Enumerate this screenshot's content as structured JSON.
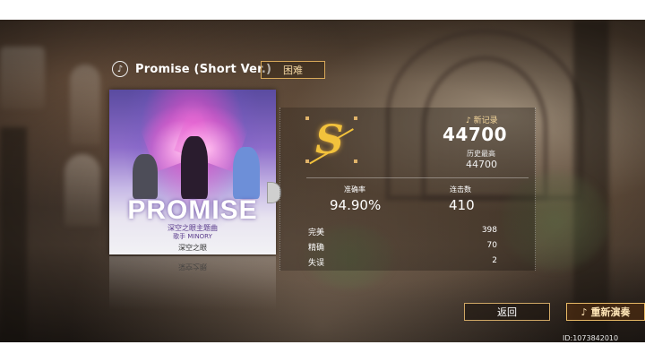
{
  "song": {
    "title": "Promise (Short Ver.)",
    "difficulty": "困难",
    "disc_icon": "disc-icon"
  },
  "cover": {
    "title": "PROMISE",
    "subtitle": "深空之眼主题曲",
    "artist": "歌手 MINORY",
    "logo": "深空之眼"
  },
  "result": {
    "rank": "S",
    "new_record_label": "♪ 新记录",
    "score": "44700",
    "best_label": "历史最高",
    "best_score": "44700",
    "accuracy_label": "准确率",
    "accuracy": "94.90%",
    "combo_label": "连击数",
    "combo": "410",
    "judgements": [
      {
        "label": "完美",
        "value": "398"
      },
      {
        "label": "精确",
        "value": "70"
      },
      {
        "label": "失误",
        "value": "2"
      }
    ]
  },
  "actions": {
    "back_label": "返回",
    "replay_label": "重新演奏",
    "replay_icon": "♪"
  },
  "footer": {
    "player_id": "ID:1073842010"
  },
  "colors": {
    "accent_gold": "#f2c23c",
    "border_gold": "#d8a95a"
  }
}
